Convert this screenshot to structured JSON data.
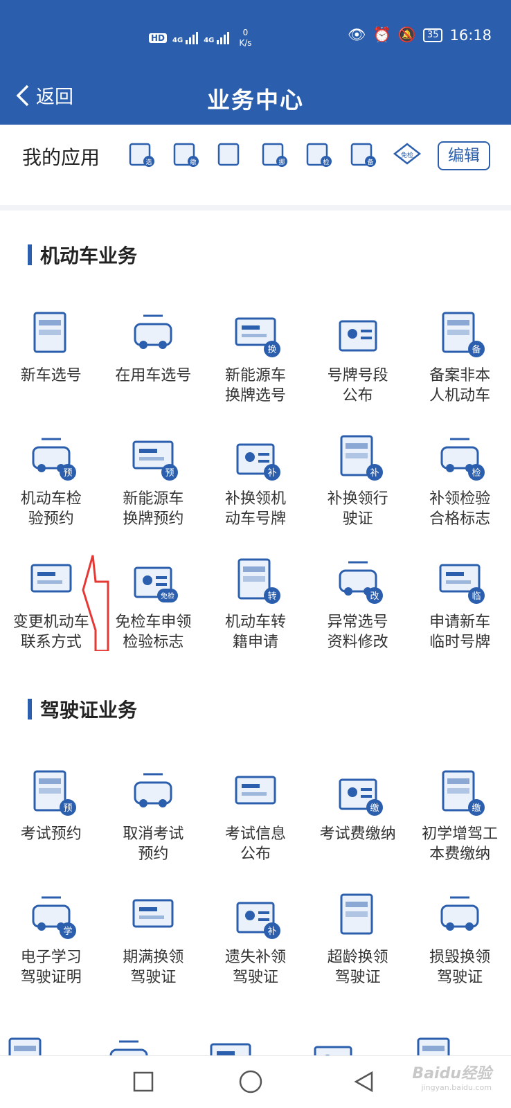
{
  "status": {
    "hd": "HD",
    "network1": "4G",
    "network2": "4G",
    "speed_value": "0",
    "speed_unit": "K/s",
    "battery": "35",
    "time": "16:18"
  },
  "header": {
    "back_label": "返回",
    "title": "业务中心"
  },
  "my_apps": {
    "label": "我的应用",
    "edit_label": "编辑",
    "apps": [
      {
        "badge": "选"
      },
      {
        "badge": "缴"
      },
      {
        "badge": ""
      },
      {
        "badge": "挪"
      },
      {
        "badge": "检"
      },
      {
        "badge": "备"
      },
      {
        "badge": "免检"
      }
    ]
  },
  "vehicle_section": {
    "title": "机动车业务",
    "items": [
      {
        "label": "新车选号",
        "badge": ""
      },
      {
        "label": "在用车选号",
        "badge": ""
      },
      {
        "label": "新能源车\n换牌选号",
        "badge": "换"
      },
      {
        "label": "号牌号段\n公布",
        "badge": ""
      },
      {
        "label": "备案非本\n人机动车",
        "badge": "备"
      },
      {
        "label": "机动车检\n验预约",
        "badge": "预"
      },
      {
        "label": "新能源车\n换牌预约",
        "badge": "预"
      },
      {
        "label": "补换领机\n动车号牌",
        "badge": "补"
      },
      {
        "label": "补换领行\n驶证",
        "badge": "补"
      },
      {
        "label": "补领检验\n合格标志",
        "badge": "检"
      },
      {
        "label": "变更机动车\n联系方式",
        "badge": ""
      },
      {
        "label": "免检车申领\n检验标志",
        "badge": "免检"
      },
      {
        "label": "机动车转\n籍申请",
        "badge": "转"
      },
      {
        "label": "异常选号\n资料修改",
        "badge": "改"
      },
      {
        "label": "申请新车\n临时号牌",
        "badge": "临"
      }
    ]
  },
  "license_section": {
    "title": "驾驶证业务",
    "items": [
      {
        "label": "考试预约",
        "badge": "预"
      },
      {
        "label": "取消考试\n预约",
        "badge": ""
      },
      {
        "label": "考试信息\n公布",
        "badge": ""
      },
      {
        "label": "考试费缴纳",
        "badge": "缴"
      },
      {
        "label": "初学增驾工\n本费缴纳",
        "badge": "缴"
      },
      {
        "label": "电子学习\n驾驶证明",
        "badge": "学"
      },
      {
        "label": "期满换领\n驾驶证",
        "badge": ""
      },
      {
        "label": "遗失补领\n驾驶证",
        "badge": "补"
      },
      {
        "label": "超龄换领\n驾驶证",
        "badge": ""
      },
      {
        "label": "损毁换领\n驾驶证",
        "badge": ""
      }
    ]
  },
  "watermark": {
    "main": "Baidu经验",
    "sub": "jingyan.baidu.com"
  },
  "colors": {
    "primary": "#2b5fae",
    "annotation": "#e53935"
  }
}
